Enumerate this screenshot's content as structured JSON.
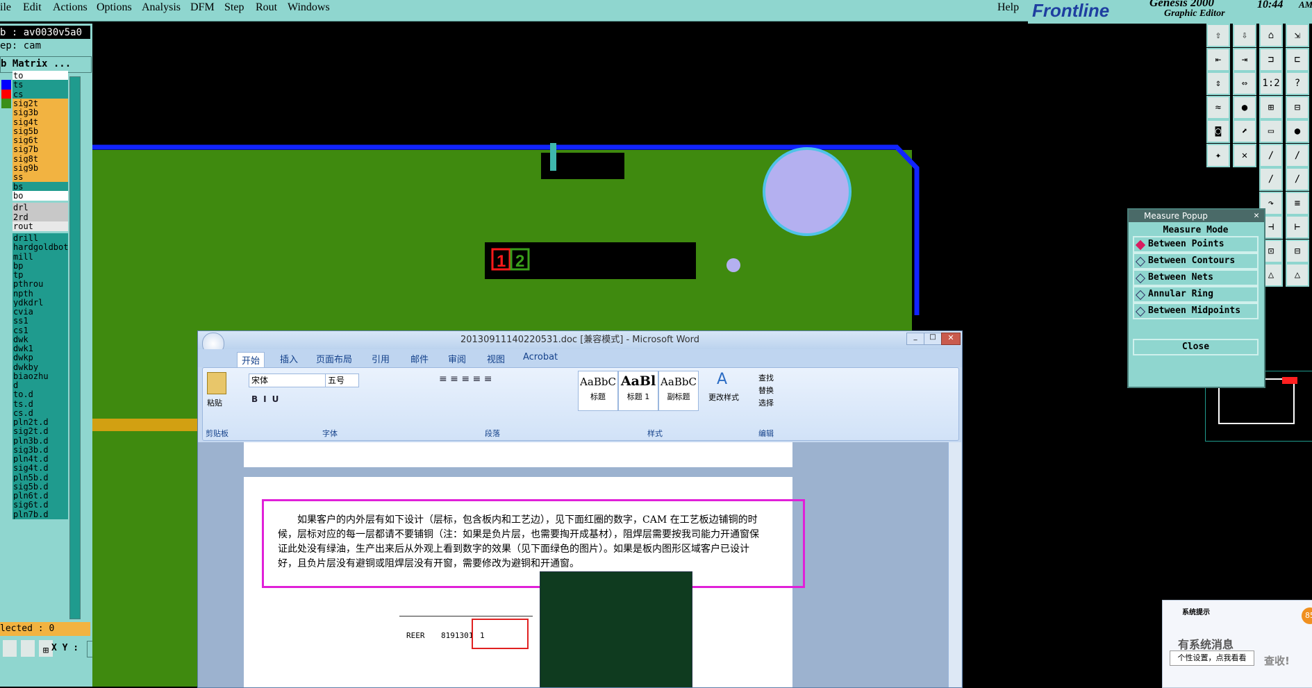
{
  "menu": {
    "items": [
      "ile",
      "Edit",
      "Actions",
      "Options",
      "Analysis",
      "DFM",
      "Step",
      "Rout",
      "Windows"
    ],
    "help": "Help",
    "brand": "Frontline",
    "product": "Genesis 2000",
    "subtitle": "Graphic Editor",
    "time": "10:44",
    "ampm": "AM"
  },
  "leftpanel": {
    "job": "b : av0030v5a0",
    "step": "ep: cam",
    "matrix": "b Matrix ...",
    "selected": "lected : 0",
    "xy_label": "X Y :",
    "layers": [
      {
        "name": "to",
        "bg": "#ffffff",
        "swatch": ""
      },
      {
        "name": "ts",
        "bg": "#1f9b8e",
        "swatch": "#0000ff"
      },
      {
        "name": "cs",
        "bg": "#1f9b8e",
        "swatch": "#ff0000"
      },
      {
        "name": "sig2t",
        "bg": "#f2b341",
        "swatch": "#3a8f1a"
      },
      {
        "name": "sig3b",
        "bg": "#f2b341",
        "swatch": ""
      },
      {
        "name": "sig4t",
        "bg": "#f2b341",
        "swatch": ""
      },
      {
        "name": "sig5b",
        "bg": "#f2b341",
        "swatch": ""
      },
      {
        "name": "sig6t",
        "bg": "#f2b341",
        "swatch": ""
      },
      {
        "name": "sig7b",
        "bg": "#f2b341",
        "swatch": ""
      },
      {
        "name": "sig8t",
        "bg": "#f2b341",
        "swatch": ""
      },
      {
        "name": "sig9b",
        "bg": "#f2b341",
        "swatch": ""
      },
      {
        "name": "ss",
        "bg": "#f2b341",
        "swatch": ""
      },
      {
        "name": "bs",
        "bg": "#1f9b8e",
        "swatch": ""
      },
      {
        "name": "bo",
        "bg": "#ffffff",
        "swatch": ""
      }
    ],
    "drill_layers": [
      {
        "name": "drl",
        "bg": "#c8c8c8"
      },
      {
        "name": "2rd",
        "bg": "#c8c8c8"
      },
      {
        "name": "rout",
        "bg": "#e8e8e8"
      }
    ],
    "misc_layers": [
      "drill",
      "hardgoldbott",
      "mill",
      "bp",
      "tp",
      "pthrou",
      "npth",
      "ydkdrl",
      "cvia",
      "ss1",
      "cs1",
      "dwk",
      "dwk1",
      "dwkp",
      "dwkby",
      "biaozhu",
      "d",
      "to.d",
      "ts.d",
      "cs.d",
      "pln2t.d",
      "sig2t.d",
      "pln3b.d",
      "sig3b.d",
      "pln4t.d",
      "sig4t.d",
      "pln5b.d",
      "sig5b.d",
      "pln6t.d",
      "sig6t.d",
      "pln7b.d"
    ]
  },
  "canvas": {
    "label1": "1",
    "label2": "2"
  },
  "measure": {
    "title": "Measure Popup",
    "mode": "Measure Mode",
    "options": [
      "Between Points",
      "Between Contours",
      "Between Nets",
      "Annular Ring",
      "Between Midpoints"
    ],
    "close": "Close"
  },
  "righttools": {
    "icon_labels": [
      "1:2",
      "?"
    ]
  },
  "word": {
    "title": "20130911140220531.doc [兼容模式] - Microsoft Word",
    "tabs": [
      "开始",
      "插入",
      "页面布局",
      "引用",
      "邮件",
      "审阅",
      "视图",
      "Acrobat"
    ],
    "font_name": "宋体",
    "font_size": "五号",
    "groups": [
      "剪贴板",
      "字体",
      "段落",
      "样式",
      "编辑"
    ],
    "paste": "粘贴",
    "styles": [
      {
        "sample": "AaBbC",
        "name": "标题"
      },
      {
        "sample": "AaBl",
        "name": "标题 1"
      },
      {
        "sample": "AaBbC",
        "name": "副标题"
      }
    ],
    "change_styles": "更改样式",
    "find": "查找",
    "replace": "替换",
    "select": "选择",
    "paragraph": "如果客户的内外层有如下设计（层标，包含板内和工艺边），见下面红圈的数字，CAM 在工艺板边铺铜的时候，层标对应的每一层都请不要铺铜（注：如果是负片层，也需要掏开成基材），阻焊层需要按我司能力开通窗保证此处没有绿油，生产出来后从外观上看到数字的效果（见下面绿色的图片）。如果是板内图形区域客户已设计好，且负片层没有避铜或阻焊层没有开窗，需要修改为避铜和开通窗。",
    "table_left": "REER",
    "table_num": "8191301",
    "table_cell": "1"
  },
  "notify": {
    "title": "系统提示",
    "headline": "有系统消息",
    "tooltip": "个性设置，点我看看",
    "link": "查收!",
    "badge": "85"
  }
}
